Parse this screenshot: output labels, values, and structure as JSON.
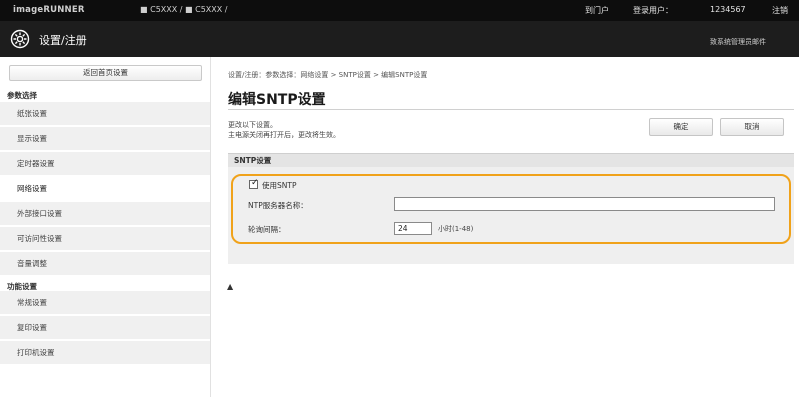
{
  "topbar": {
    "logo": "imageRUNNER",
    "model": "■ C5XXX / ■ C5XXX /",
    "portal_link": "到门户",
    "user_label": "登录用户：",
    "user_name": "1234567",
    "logout_link": "注销"
  },
  "titlebar": {
    "icon": "settings-gear-icon",
    "title": "设置/注册",
    "mail_link": "致系统管理员邮件"
  },
  "sidebar": {
    "back_button": "返回首页设置",
    "section_prefs": "参数选择",
    "prefs_items": [
      {
        "label": "纸张设置",
        "active": false
      },
      {
        "label": "显示设置",
        "active": false
      },
      {
        "label": "定时器设置",
        "active": false
      },
      {
        "label": "网络设置",
        "active": true
      },
      {
        "label": "外部接口设置",
        "active": false
      },
      {
        "label": "可访问性设置",
        "active": false
      },
      {
        "label": "音量调整",
        "active": false
      }
    ],
    "section_function": "功能设置",
    "function_items": [
      {
        "label": "常规设置",
        "active": false
      },
      {
        "label": "复印设置",
        "active": false
      },
      {
        "label": "打印机设置",
        "active": false
      }
    ]
  },
  "main": {
    "breadcrumb": "设置/注册：参数选择：网络设置 > SNTP设置 > 编辑SNTP设置",
    "page_title": "编辑SNTP设置",
    "desc_line1": "更改以下设置。",
    "desc_line2": "主电源关闭再打开后，更改将生效。",
    "ok_button": "确定",
    "cancel_button": "取消",
    "section_title": "SNTP设置",
    "use_sntp_label": "使用SNTP",
    "use_sntp_checked": true,
    "server_label": "NTP服务器名称：",
    "server_value": "",
    "interval_label": "轮询间隔：",
    "interval_value": "24",
    "interval_unit": "小时(1-48)",
    "back_to_top": "▲"
  },
  "colors": {
    "highlight": "#f0a21a",
    "topbar": "#0d0d0d",
    "titlebar": "#1d1d1d"
  }
}
